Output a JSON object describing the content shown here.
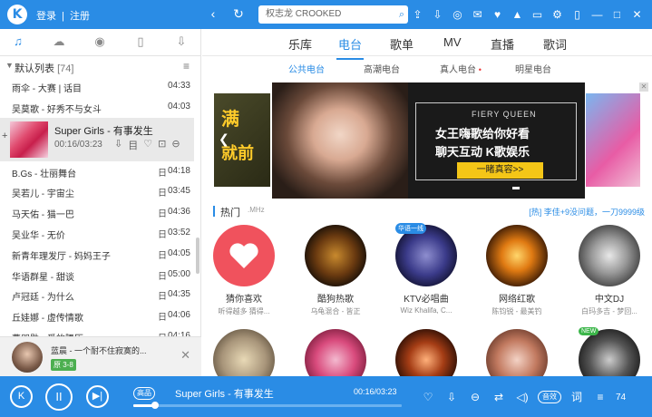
{
  "topbar": {
    "logo": "K",
    "login": "登录",
    "separator": "|",
    "register": "注册",
    "back_icon": "‹",
    "refresh_icon": "↻",
    "search_text": "权志龙 CROOKED",
    "search_icon": "⌕"
  },
  "left": {
    "list_title": "默认列表",
    "list_count": "[74]",
    "songs": [
      {
        "name": "雨伞 - 大赛 | 话目",
        "duration": "04:33"
      },
      {
        "name": "吴莫歌 - 好秀不与女斗",
        "duration": "04:03"
      }
    ],
    "playing": {
      "name": "Super Girls - 有事发生",
      "time": "00:16/03:23"
    },
    "songs_after": [
      {
        "name": "B.Gs - 壮丽舞台",
        "hq": "日",
        "duration": "04:18"
      },
      {
        "name": "吴若儿 - 宇宙尘",
        "hq": "日",
        "duration": "03:45"
      },
      {
        "name": "马天佑 - 猫一巴",
        "hq": "日",
        "duration": "04:36"
      },
      {
        "name": "吴业华 - 无价",
        "hq": "日",
        "duration": "03:52"
      },
      {
        "name": "新青年理发厅 - 妈妈王子",
        "hq": "日",
        "duration": "04:05"
      },
      {
        "name": "华语群星 - 甜谈",
        "hq": "日",
        "duration": "05:00"
      },
      {
        "name": "卢冠廷 - 为什么",
        "hq": "日",
        "duration": "04:35"
      },
      {
        "name": "丘娃娜 - 虚传情歌",
        "hq": "日",
        "duration": "04:06"
      },
      {
        "name": "曹朋勋 - 爱的腰历",
        "hq": "日",
        "duration": "04:16"
      }
    ],
    "now_playing": {
      "title": "蓝晨 - 一个耐不住寂寞的...",
      "badge": "原 3-8"
    }
  },
  "main": {
    "tabs": [
      "乐库",
      "电台",
      "歌单",
      "MV",
      "直播",
      "歌词"
    ],
    "sub_tabs": [
      "公共电台",
      "高潮电台",
      "真人电台",
      "明星电台"
    ],
    "banner": {
      "left_t1": "满",
      "left_t2": "就前",
      "brand": "FIERY QUEEN",
      "line1": "女王嗨歌给你好看",
      "line2": "聊天互动 K歌娱乐",
      "button": "一睹真容>>"
    },
    "hot": {
      "title": "热门",
      "suffix": ".MHz",
      "ad": "[热] 李佳+9没问题，一刀9999级"
    },
    "radios": [
      {
        "label": "猜你喜欢",
        "sub": "听得越多 猜得...",
        "tag": ""
      },
      {
        "label": "酷狗热歌",
        "sub": "乌龟混合 - 皆正",
        "tag": ""
      },
      {
        "label": "KTV必唱曲",
        "sub": "Wiz Khalifa, C...",
        "tag": "华语一线"
      },
      {
        "label": "网络红歌",
        "sub": "陈钧锐 - 最美钓",
        "tag": ""
      },
      {
        "label": "中文DJ",
        "sub": "白玛多吉 - 梦回...",
        "tag": ""
      }
    ],
    "radios_row2_tag": "NEW"
  },
  "player": {
    "prev": "K",
    "play": "II",
    "next": "▶|",
    "quality": "高品",
    "title": "Super Girls - 有事发生",
    "time": "00:16/03:23",
    "progress": 0.08,
    "icons": [
      "heart-icon",
      "download-icon",
      "more-icon",
      "random-icon",
      "volume-icon"
    ],
    "pill": "音效",
    "lyric": "词",
    "count": "74"
  },
  "colors": {
    "accent": "#2a8ce5"
  }
}
